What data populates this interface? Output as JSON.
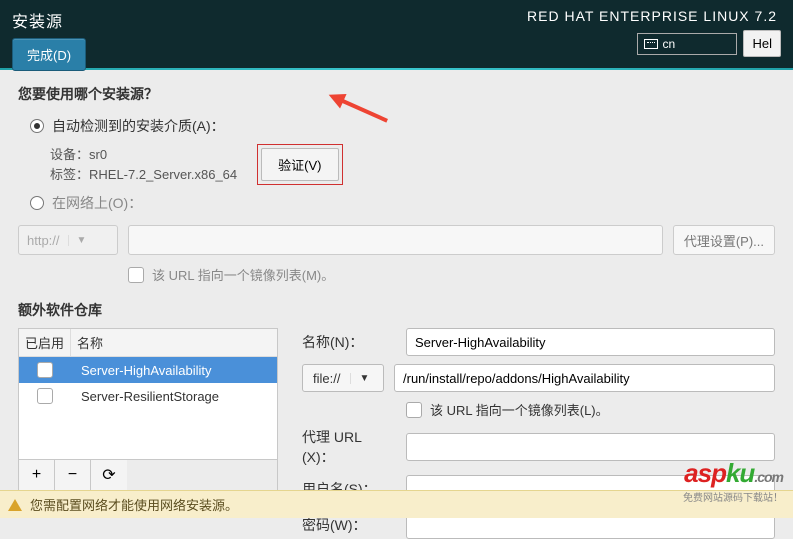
{
  "header": {
    "title": "安装源",
    "done_label": "完成(D)",
    "distro": "RED HAT ENTERPRISE LINUX 7.2",
    "keyboard": "cn",
    "help_label": "Hel"
  },
  "source": {
    "question": "您要使用哪个安装源？",
    "auto_label": "自动检测到的安装介质(A)：",
    "device_line": "设备：sr0",
    "label_line": "标签：RHEL-7.2_Server.x86_64",
    "verify_label": "验证(V)",
    "network_label": "在网络上(O)：",
    "protocol": "http://",
    "proxy_label": "代理设置(P)...",
    "mirror_label": "该 URL 指向一个镜像列表(M)。"
  },
  "repos": {
    "section_label": "额外软件仓库",
    "col_enabled": "已启用",
    "col_name": "名称",
    "rows": [
      {
        "name": "Server-HighAvailability"
      },
      {
        "name": "Server-ResilientStorage"
      }
    ],
    "add": "+",
    "remove": "−",
    "refresh": "⟳",
    "form": {
      "name_label": "名称(N)：",
      "name_value": "Server-HighAvailability",
      "proto": "file://",
      "path_value": "/run/install/repo/addons/HighAvailability",
      "mirror_label": "该 URL 指向一个镜像列表(L)。",
      "proxy_url_label": "代理 URL (X)：",
      "user_label": "用户名(S)：",
      "pass_label": "密码(W)："
    }
  },
  "footer": {
    "warning": "您需配置网络才能使用网络安装源。"
  },
  "watermark": {
    "brand_red": "asp",
    "brand_green": "ku",
    "brand_com": ".com",
    "tagline": "免费网站源码下载站！"
  }
}
